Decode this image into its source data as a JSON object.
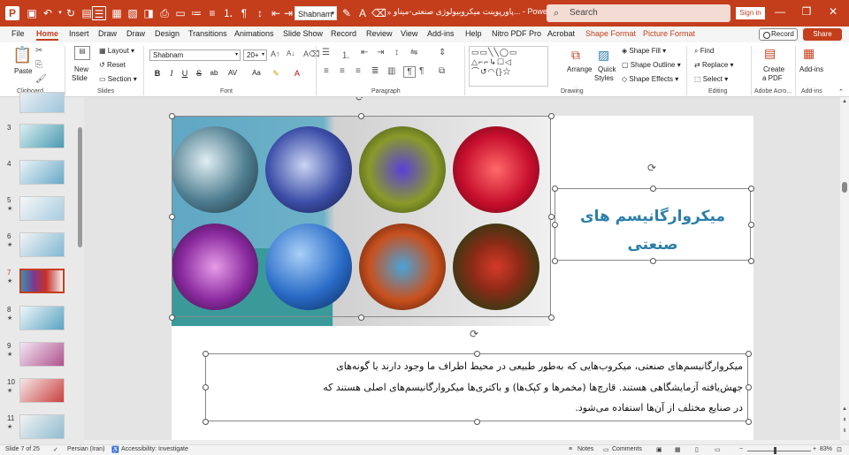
{
  "app": {
    "font_name_box": "Shabnam",
    "document_title": "پاورپوینت میکروبیولوژی صنعتی-میناو... - Powe...",
    "search_placeholder": "Search",
    "sign_in": "Sign in"
  },
  "menu": {
    "items": [
      "File",
      "Home",
      "Insert",
      "Draw",
      "Draw",
      "Design",
      "Transitions",
      "Animations",
      "Slide Show",
      "Record",
      "Review",
      "View",
      "Add-ins",
      "Help",
      "Nitro PDF Pro",
      "Acrobat"
    ],
    "contextual": [
      "Shape Format",
      "Picture Format"
    ],
    "active": "Home",
    "record_label": "Record",
    "share_label": "Share"
  },
  "ribbon": {
    "clipboard": {
      "paste": "Paste",
      "label": "Clipboard"
    },
    "slides": {
      "new_slide_1": "New",
      "new_slide_2": "Slide",
      "layout": "Layout",
      "reset": "Reset",
      "section": "Section",
      "label": "Slides"
    },
    "font": {
      "font_name": "Shabnam",
      "font_size": "20+",
      "bold": "B",
      "italic": "I",
      "underline": "U",
      "strike": "S",
      "label": "Font"
    },
    "paragraph": {
      "label": "Paragraph"
    },
    "drawing": {
      "arrange": "Arrange",
      "quick_styles_1": "Quick",
      "quick_styles_2": "Styles",
      "shape_fill": "Shape Fill",
      "shape_outline": "Shape Outline",
      "shape_effects": "Shape Effects",
      "label": "Drawing"
    },
    "editing": {
      "find": "Find",
      "replace": "Replace",
      "select": "Select",
      "label": "Editing"
    },
    "adobe": {
      "create_1": "Create",
      "create_2": "a PDF",
      "label": "Adobe Acro..."
    },
    "addins": {
      "addins": "Add-ins",
      "label": "Add-ins"
    }
  },
  "thumbnails": [
    {
      "num": "",
      "star": false
    },
    {
      "num": "3",
      "star": false
    },
    {
      "num": "4",
      "star": false
    },
    {
      "num": "5",
      "star": true
    },
    {
      "num": "6",
      "star": true
    },
    {
      "num": "7",
      "star": true,
      "active": true
    },
    {
      "num": "8",
      "star": true
    },
    {
      "num": "9",
      "star": true
    },
    {
      "num": "10",
      "star": true
    },
    {
      "num": "11",
      "star": true
    }
  ],
  "slide": {
    "title_line1": "میکروارگانیسم های",
    "title_line2": "صنعتی",
    "body_line1": "میکروارگانیسم‌های صنعتی، میکروب‌هایی که به‌طور طبیعی در محیط اطراف ما وجود دارند یا گونه‌های",
    "body_line2": "جهش‌یافته آزمایشگاهی هستند. قارچ‌ها (مخمرها و کپک‌ها) و باکتری‌ها میکروارگانیسم‌های اصلی هستند که",
    "body_line3": "در صنایع مختلف از آن‌ها استفاده می‌شود."
  },
  "status": {
    "slide_of": "Slide 7 of 25",
    "language": "Persian (Iran)",
    "accessibility": "Accessibility: Investigate",
    "notes": "Notes",
    "comments": "Comments",
    "zoom": "83%"
  },
  "colors": {
    "accent": "#c43e1c",
    "title_blue": "#2c7fa9"
  }
}
